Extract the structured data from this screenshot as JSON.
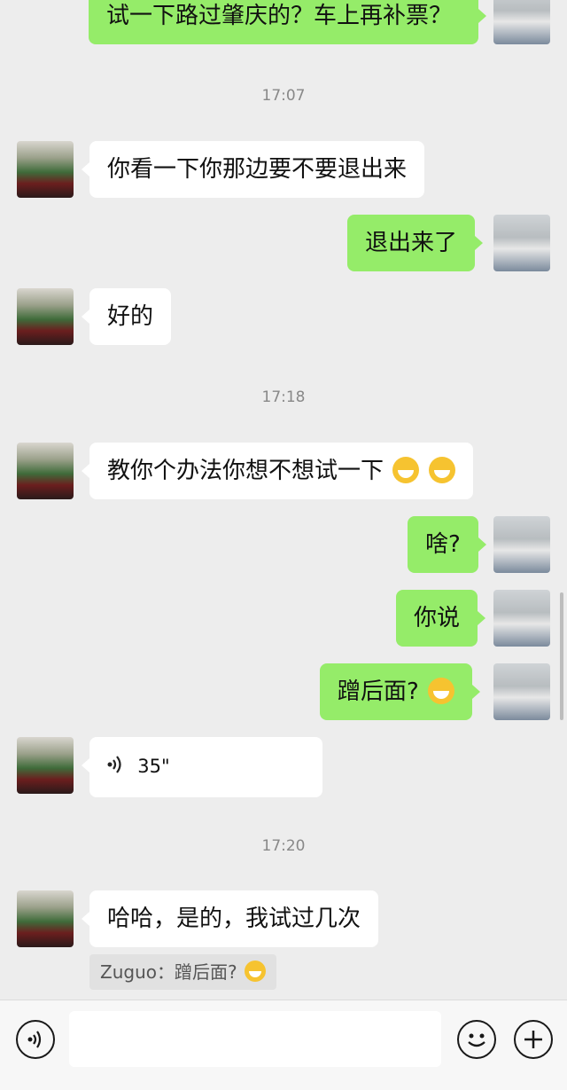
{
  "messages": {
    "top_partial": "试一下路过肇庆的？车上再补票？",
    "ts1": "17:07",
    "m1": "你看一下你那边要不要退出来",
    "m2": "退出来了",
    "m3": "好的",
    "ts2": "17:18",
    "m4": "教你个办法你想不想试一下",
    "m5": "啥?",
    "m6": "你说",
    "m7": "蹭后面?",
    "voice_duration": "35\"",
    "ts3": "17:20",
    "m8": "哈哈，是的，我试过几次",
    "quote": "Zuguo：蹭后面?"
  },
  "colors": {
    "incoming": "#ffffff",
    "outgoing": "#95ec69",
    "background": "#ededed"
  },
  "icons": {
    "voice": "voice-icon",
    "emoji": "emoji-icon",
    "plus": "plus-icon",
    "laugh": "laughing-emoji",
    "grin": "grinning-emoji"
  }
}
